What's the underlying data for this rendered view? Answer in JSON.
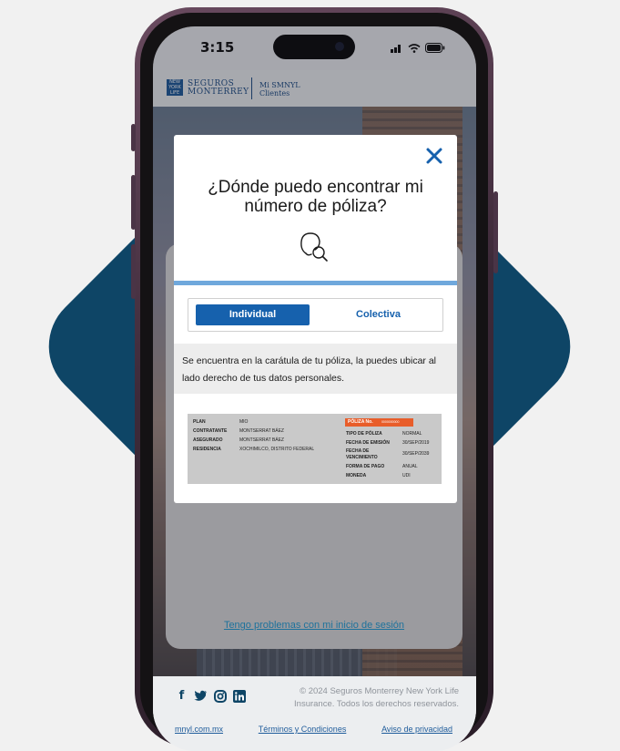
{
  "status_bar": {
    "time": "3:15"
  },
  "header": {
    "logo_text": "NEW YORK LIFE",
    "brand_line1": "SEGUROS",
    "brand_line2": "MONTERREY",
    "portal_line1": "Mi SMNYL",
    "portal_line2": "Clientes"
  },
  "background_card": {
    "help_link": "Tengo problemas con mi inicio de sesión"
  },
  "modal": {
    "title": "¿Dónde puedo encontrar mi número de póliza?",
    "tabs": [
      {
        "label": "Individual",
        "selected": true
      },
      {
        "label": "Colectiva",
        "selected": false
      }
    ],
    "info_text": "Se encuentra en la carátula de tu póliza, la puedes ubicar al lado derecho de tus datos personales."
  },
  "policy_sample": {
    "left_rows": [
      {
        "label": "PLAN",
        "value": "MIO"
      },
      {
        "label": "CONTRATANTE",
        "value": "MONTSERRAT BÁEZ"
      },
      {
        "label": "ASEGURADO",
        "value": "MONTSERRAT BÁEZ"
      },
      {
        "label": "RESIDENCIA",
        "value": "XOCHIMILCO, DISTRITO FEDERAL"
      }
    ],
    "poliza_label": "PÓLIZA No.",
    "poliza_number": "0000000000",
    "right_rows": [
      {
        "label": "TIPO DE PÓLIZA",
        "value": "NORMAL"
      },
      {
        "label": "FECHA DE EMISIÓN",
        "value": "30/SEP/2019"
      },
      {
        "label": "FECHA DE VENCIMIENTO",
        "value": "30/SEP/2039"
      },
      {
        "label": "FORMA DE PAGO",
        "value": "ANUAL"
      },
      {
        "label": "MONEDA",
        "value": "UDI"
      }
    ]
  },
  "footer": {
    "copyright": "© 2024 Seguros Monterrey New York Life Insurance. Todos los derechos reservados.",
    "links": [
      "mnyl.com.mx",
      "Términos y Condiciones",
      "Aviso de privacidad"
    ]
  },
  "colors": {
    "brand_blue": "#1661ad",
    "dark_teal": "#0e4566",
    "accent_orange": "#e85d2a",
    "link_blue": "#24a0d8"
  }
}
